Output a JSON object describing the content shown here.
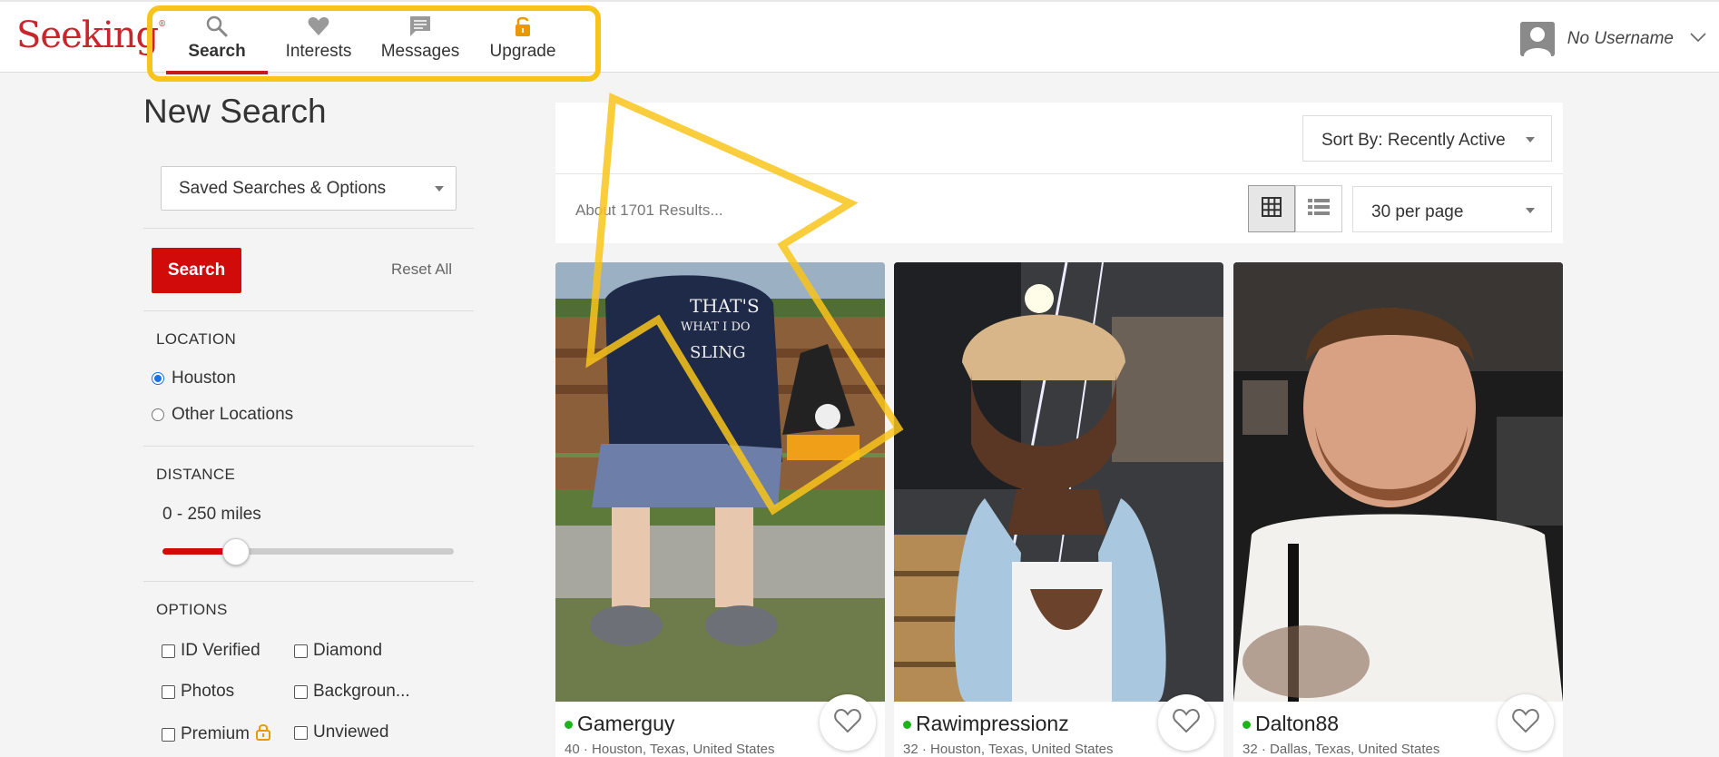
{
  "header": {
    "logo": "Seeking",
    "nav": [
      {
        "label": "Search",
        "icon": "search-icon"
      },
      {
        "label": "Interests",
        "icon": "heart-icon"
      },
      {
        "label": "Messages",
        "icon": "message-icon"
      },
      {
        "label": "Upgrade",
        "icon": "lock-icon"
      }
    ],
    "username": "No Username"
  },
  "sidebar": {
    "title": "New Search",
    "saved_searches": "Saved Searches & Options",
    "search_button": "Search",
    "reset": "Reset All",
    "location_label": "LOCATION",
    "locations": [
      "Houston",
      "Other Locations"
    ],
    "location_selected": "Houston",
    "distance_label": "DISTANCE",
    "distance_text": "0 - 250 miles",
    "distance_level": 0.25,
    "options_label": "OPTIONS",
    "options": [
      "ID Verified",
      "Diamond",
      "Photos",
      "Backgroun...",
      "Premium",
      "Unviewed"
    ]
  },
  "results": {
    "sort": "Sort By: Recently Active",
    "count": "About 1701 Results...",
    "per_page": "30 per page",
    "profiles": [
      {
        "name": "Gamerguy",
        "meta": "40 · Houston, Texas, United States"
      },
      {
        "name": "Rawimpressionz",
        "meta": "32 · Houston, Texas, United States"
      },
      {
        "name": "Dalton88",
        "meta": "32 · Dallas, Texas, United States"
      }
    ]
  },
  "colors": {
    "brand": "#c9252c",
    "accent_red": "#d10a0a",
    "highlight": "#f9c41a",
    "online": "#1db31d"
  }
}
